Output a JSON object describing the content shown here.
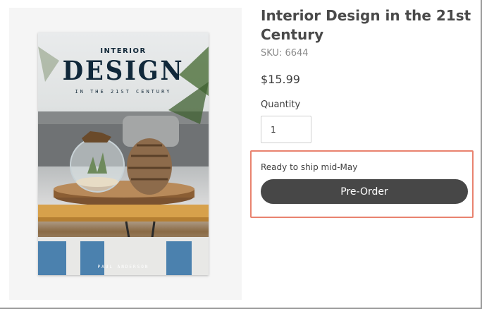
{
  "product": {
    "title": "Interior Design in the 21st Century",
    "sku": "SKU: 6644",
    "price": "$15.99",
    "quantity_label": "Quantity",
    "quantity_value": "1",
    "shipping_note": "Ready to ship mid-May",
    "preorder_label": "Pre-Order"
  },
  "cover": {
    "kicker": "INTERIOR",
    "title": "DESIGN",
    "subtitle": "IN THE 21ST CENTURY",
    "author": "PAUL ANDERSON"
  },
  "colors": {
    "button": "#474747",
    "highlight_border": "#e9836f",
    "image_panel": "#f5f5f5"
  }
}
